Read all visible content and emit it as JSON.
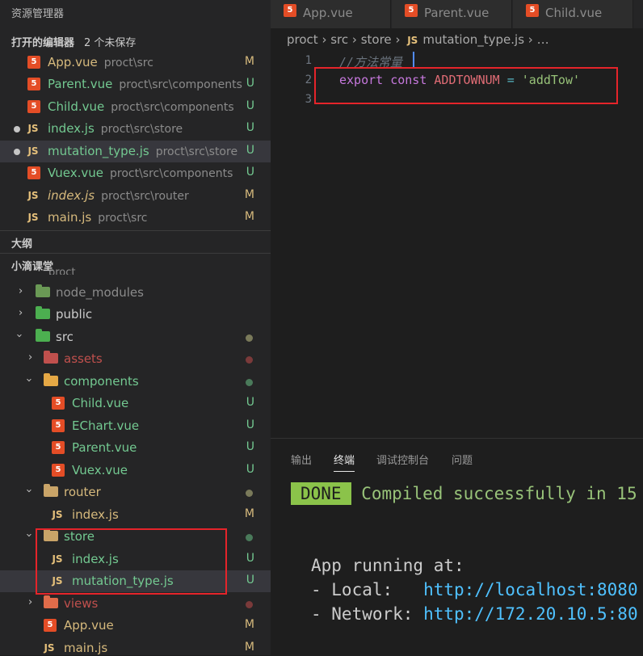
{
  "sidebar": {
    "title": "资源管理器",
    "open_editors": {
      "header": "打开的编辑器",
      "unsaved": "2 个未保存",
      "items": [
        {
          "name": "App.vue",
          "path": "proct\\src",
          "badge": "M",
          "icon": "html5-icon"
        },
        {
          "name": "Parent.vue",
          "path": "proct\\src\\components",
          "badge": "U",
          "icon": "html5-icon"
        },
        {
          "name": "Child.vue",
          "path": "proct\\src\\components",
          "badge": "U",
          "icon": "html5-icon"
        },
        {
          "name": "index.js",
          "path": "proct\\src\\store",
          "badge": "U",
          "icon": "js-icon"
        },
        {
          "name": "mutation_type.js",
          "path": "proct\\src\\store",
          "badge": "U",
          "icon": "js-icon"
        },
        {
          "name": "Vuex.vue",
          "path": "proct\\src\\components",
          "badge": "U",
          "icon": "html5-icon"
        },
        {
          "name": "index.js",
          "path": "proct\\src\\router",
          "badge": "M",
          "icon": "js-icon"
        },
        {
          "name": "main.js",
          "path": "proct\\src",
          "badge": "M",
          "icon": "js-icon"
        }
      ]
    },
    "outline": {
      "header": "大纲"
    },
    "project": {
      "header": "小滴课堂",
      "truncated_label": "proct",
      "tree": [
        {
          "name": "node_modules"
        },
        {
          "name": "public"
        },
        {
          "name": "src"
        },
        {
          "name": "assets"
        },
        {
          "name": "components"
        },
        {
          "name": "Child.vue",
          "badge": "U"
        },
        {
          "name": "EChart.vue",
          "badge": "U"
        },
        {
          "name": "Parent.vue",
          "badge": "U"
        },
        {
          "name": "Vuex.vue",
          "badge": "U"
        },
        {
          "name": "router"
        },
        {
          "name": "index.js",
          "badge": "M"
        },
        {
          "name": "store"
        },
        {
          "name": "index.js",
          "badge": "U"
        },
        {
          "name": "mutation_type.js",
          "badge": "U"
        },
        {
          "name": "views"
        },
        {
          "name": "App.vue",
          "badge": "M"
        },
        {
          "name": "main.js",
          "badge": "M"
        }
      ]
    }
  },
  "tabs": [
    {
      "label": "App.vue",
      "icon": "html5-icon"
    },
    {
      "label": "Parent.vue",
      "icon": "html5-icon"
    },
    {
      "label": "Child.vue",
      "icon": "html5-icon"
    }
  ],
  "breadcrumb": {
    "parts": [
      "proct",
      "src",
      "store",
      "mutation_type.js",
      "…"
    ],
    "sep": "›",
    "file_icon": "JS"
  },
  "editor": {
    "line_numbers": [
      "1",
      "2",
      "3"
    ],
    "comment": "//方法常量",
    "kw_export": "export",
    "kw_const": "const",
    "const_name": "ADDTOWNUM",
    "op": "=",
    "value": "'addTow'"
  },
  "panel": {
    "tabs": [
      "输出",
      "终端",
      "调试控制台",
      "问题"
    ],
    "active_tab": "终端",
    "done": "DONE",
    "compiled": "Compiled successfully in 15",
    "running": "App running at:",
    "local_label": "- Local:   ",
    "local_url": "http://localhost:8080",
    "network_label": "- Network: ",
    "network_url": "http://172.20.10.5:80"
  },
  "colors": {
    "highlight_box": "#e5242a",
    "untracked": "#73c991",
    "modified": "#d7ba7d"
  }
}
